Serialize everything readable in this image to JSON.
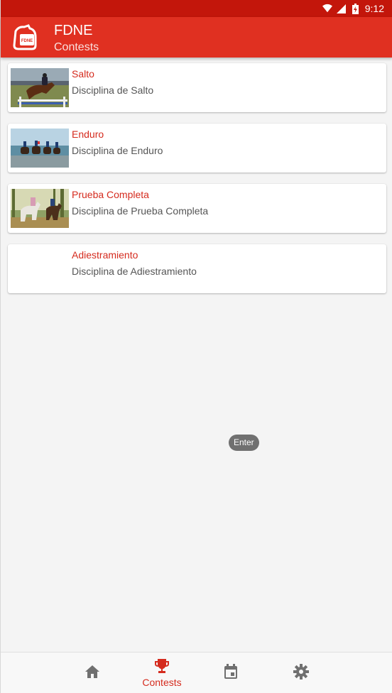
{
  "status_bar": {
    "time": "9:12"
  },
  "app_bar": {
    "title": "FDNE",
    "subtitle": "Contests",
    "logo_text": "FDNE"
  },
  "contests": [
    {
      "title": "Salto",
      "description": "Disciplina de Salto",
      "image": "show-jumping-photo"
    },
    {
      "title": "Enduro",
      "description": "Disciplina de Enduro",
      "image": "endurance-riders-beach-photo"
    },
    {
      "title": "Prueba Completa",
      "description": "Disciplina de Prueba Completa",
      "image": "eventing-riders-forest-photo"
    },
    {
      "title": "Adiestramiento",
      "description": "Disciplina de Adiestramiento",
      "image": ""
    }
  ],
  "toast": {
    "text": "Enter"
  },
  "bottom_nav": {
    "items": [
      {
        "icon": "home-icon",
        "label": ""
      },
      {
        "icon": "trophy-icon",
        "label": "Contests",
        "active": true
      },
      {
        "icon": "calendar-icon",
        "label": ""
      },
      {
        "icon": "gear-icon",
        "label": ""
      }
    ]
  },
  "colors": {
    "primary": "#e03021",
    "primary_dark": "#c3160b",
    "accent_text": "#d52b1e"
  }
}
